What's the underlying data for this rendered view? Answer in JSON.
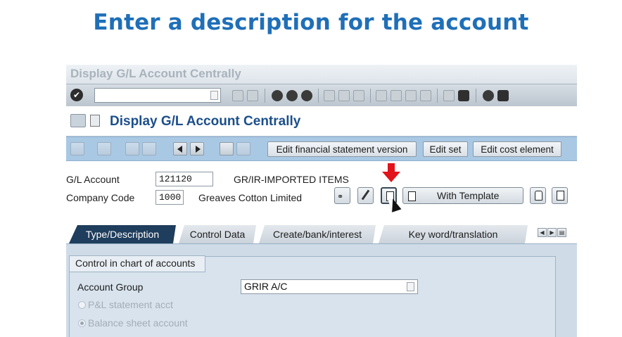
{
  "headline": "Enter a description for the account",
  "window": {
    "title": "Display G/L Account Centrally"
  },
  "screen": {
    "title": "Display G/L Account Centrally"
  },
  "toolbar": {
    "buttons": [
      "Edit financial statement version",
      "Edit set",
      "Edit cost element"
    ]
  },
  "header": {
    "gl_account_label": "G/L Account",
    "gl_account_value": "121120",
    "gl_account_desc": "GR/IR-IMPORTED ITEMS",
    "company_code_label": "Company Code",
    "company_code_value": "1000",
    "company_code_desc": "Greaves Cotton Limited",
    "with_template_label": "With Template"
  },
  "tabs": [
    {
      "label": "Type/Description",
      "active": true
    },
    {
      "label": "Control Data",
      "active": false
    },
    {
      "label": "Create/bank/interest",
      "active": false
    },
    {
      "label": "Key word/translation",
      "active": false
    }
  ],
  "panel": {
    "group_title": "Control in chart of accounts",
    "account_group_label": "Account Group",
    "account_group_value": "GRIR A/C",
    "radio_pl": "P&L statement acct",
    "radio_bs": "Balance sheet account"
  },
  "colors": {
    "headline": "#1f6fb8",
    "screen_title": "#1c4f8a",
    "app_toolbar": "#a9c8e4",
    "active_tab": "#1f3d5c",
    "arrow": "#e0141a"
  },
  "icons": [
    "ok-icon",
    "save-icon",
    "back-icon",
    "exit-icon",
    "cancel-icon",
    "print-icon",
    "find-icon",
    "help-icon",
    "glasses-icon",
    "pencil-icon",
    "create-doc-icon",
    "lock-icon",
    "trash-icon"
  ]
}
